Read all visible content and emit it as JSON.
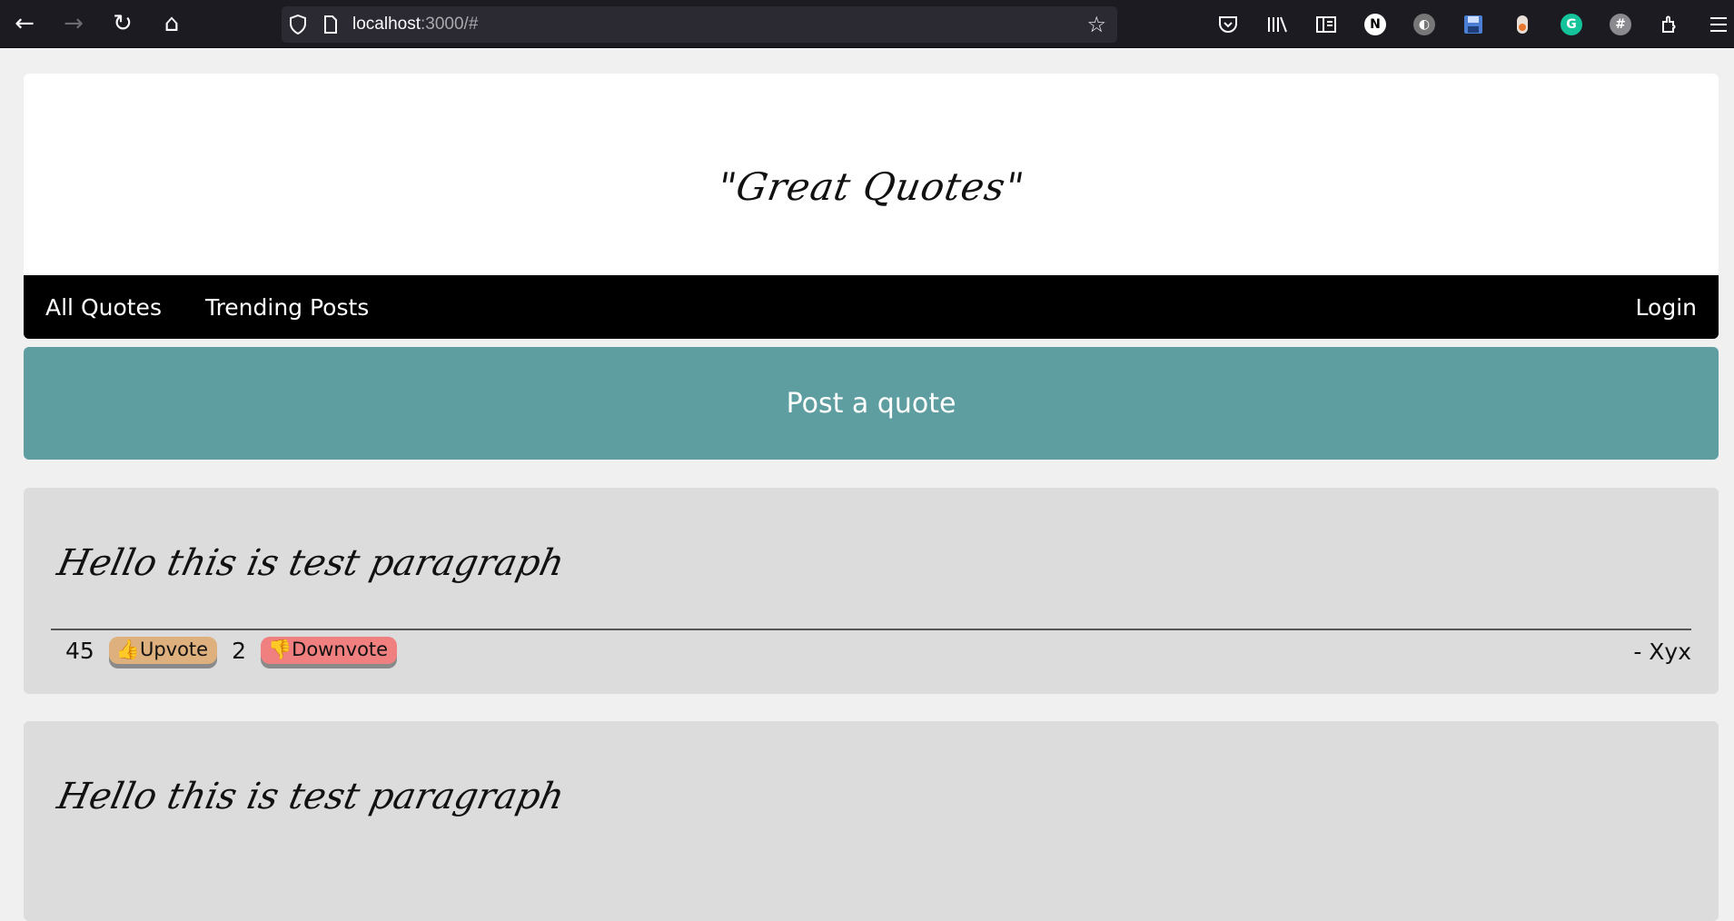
{
  "browser": {
    "url_host": "localhost",
    "url_rest": ":3000/#",
    "nav": {
      "back": "←",
      "forward": "→",
      "reload": "↻",
      "home": "⌂"
    },
    "icons": [
      "shield-icon",
      "page-icon",
      "star-icon",
      "pocket-icon",
      "library-icon",
      "reader-icon",
      "n-extension-icon",
      "dark-reader-icon",
      "save-icon",
      "record-icon",
      "grammarly-icon",
      "globe-icon",
      "extensions-icon",
      "menu-icon"
    ],
    "ext_labels": {
      "n": "N",
      "g": "G"
    }
  },
  "site": {
    "logo": "\"Great Quotes\"",
    "nav": {
      "all_quotes": "All Quotes",
      "trending": "Trending Posts",
      "login": "Login"
    },
    "post_button": "Post a quote"
  },
  "quotes": [
    {
      "text": "Hello this is test paragraph",
      "upvotes": "45",
      "upvote_label": "👍Upvote",
      "downvotes": "2",
      "downvote_label": "👎Downvote",
      "author": "- Xyx"
    },
    {
      "text": "Hello this is test paragraph"
    }
  ],
  "colors": {
    "post_button": "#5f9ea0",
    "upvote": "#ddb07e",
    "downvote": "#f08080",
    "card": "#dcdcdc"
  }
}
